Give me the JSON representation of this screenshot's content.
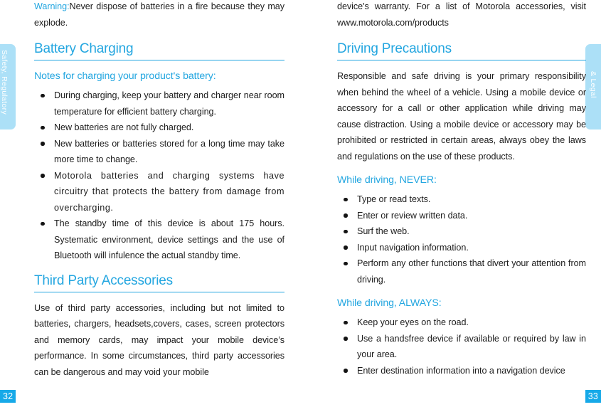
{
  "document": {
    "title": "Safety, Regulatory & Legal",
    "accent_color": "#23a6e0",
    "tab_color": "#ace0f7",
    "page_number_color": "#16a9e8"
  },
  "left_page": {
    "tab_label": "Safety, Regulatory",
    "page_number": "32",
    "warning": {
      "label": "Warning:",
      "text": "Never dispose of batteries in a fire because they may explode."
    },
    "sections": [
      {
        "heading": "Battery Charging",
        "subheading": "Notes for charging your product's battery:",
        "bullets": [
          "During charging, keep your battery and charger near room temperature for efficient battery charging.",
          "New batteries are not fully charged.",
          "New batteries or batteries stored for a long time may take more time to change.",
          "Motorola batteries and charging systems have circuitry that protects the battery from damage from overcharging.",
          "The standby time of this device is about 175 hours. Systematic environment, device settings and the use of Bluetooth will infulence the actual standby time."
        ]
      },
      {
        "heading": "Third Party Accessories",
        "paragraph": "Use of third party accessories, including but not limited to batteries, chargers, headsets,covers, cases, screen protectors and memory cards, may impact your mobile device’s performance. In some circumstances, third party accessories can be dangerous and may void your mobile"
      }
    ]
  },
  "right_page": {
    "tab_label": "& Legal",
    "page_number": "33",
    "continued_paragraph": "device's warranty. For a list of Motorola accessories, visit www.motorola.com/products",
    "sections": [
      {
        "heading": "Driving Precautions",
        "paragraph": "Responsible and safe driving is your primary responsibility when behind the wheel of a vehicle. Using a mobile device or accessory for a call or other application while driving may cause distraction. Using a mobile device or accessory may be prohibited or restricted in certain areas, always obey the laws and regulations on the use of these products.",
        "subsections": [
          {
            "subheading": "While driving, NEVER:",
            "bullets": [
              "Type or read texts.",
              "Enter or review written data.",
              "Surf the web.",
              "Input navigation information.",
              "Perform any other functions that divert your attention from driving."
            ]
          },
          {
            "subheading": "While driving, ALWAYS:",
            "bullets": [
              "Keep your eyes on the road.",
              "Use a handsfree device if available or required by law in your area.",
              "Enter destination information into a navigation device"
            ]
          }
        ]
      }
    ]
  }
}
